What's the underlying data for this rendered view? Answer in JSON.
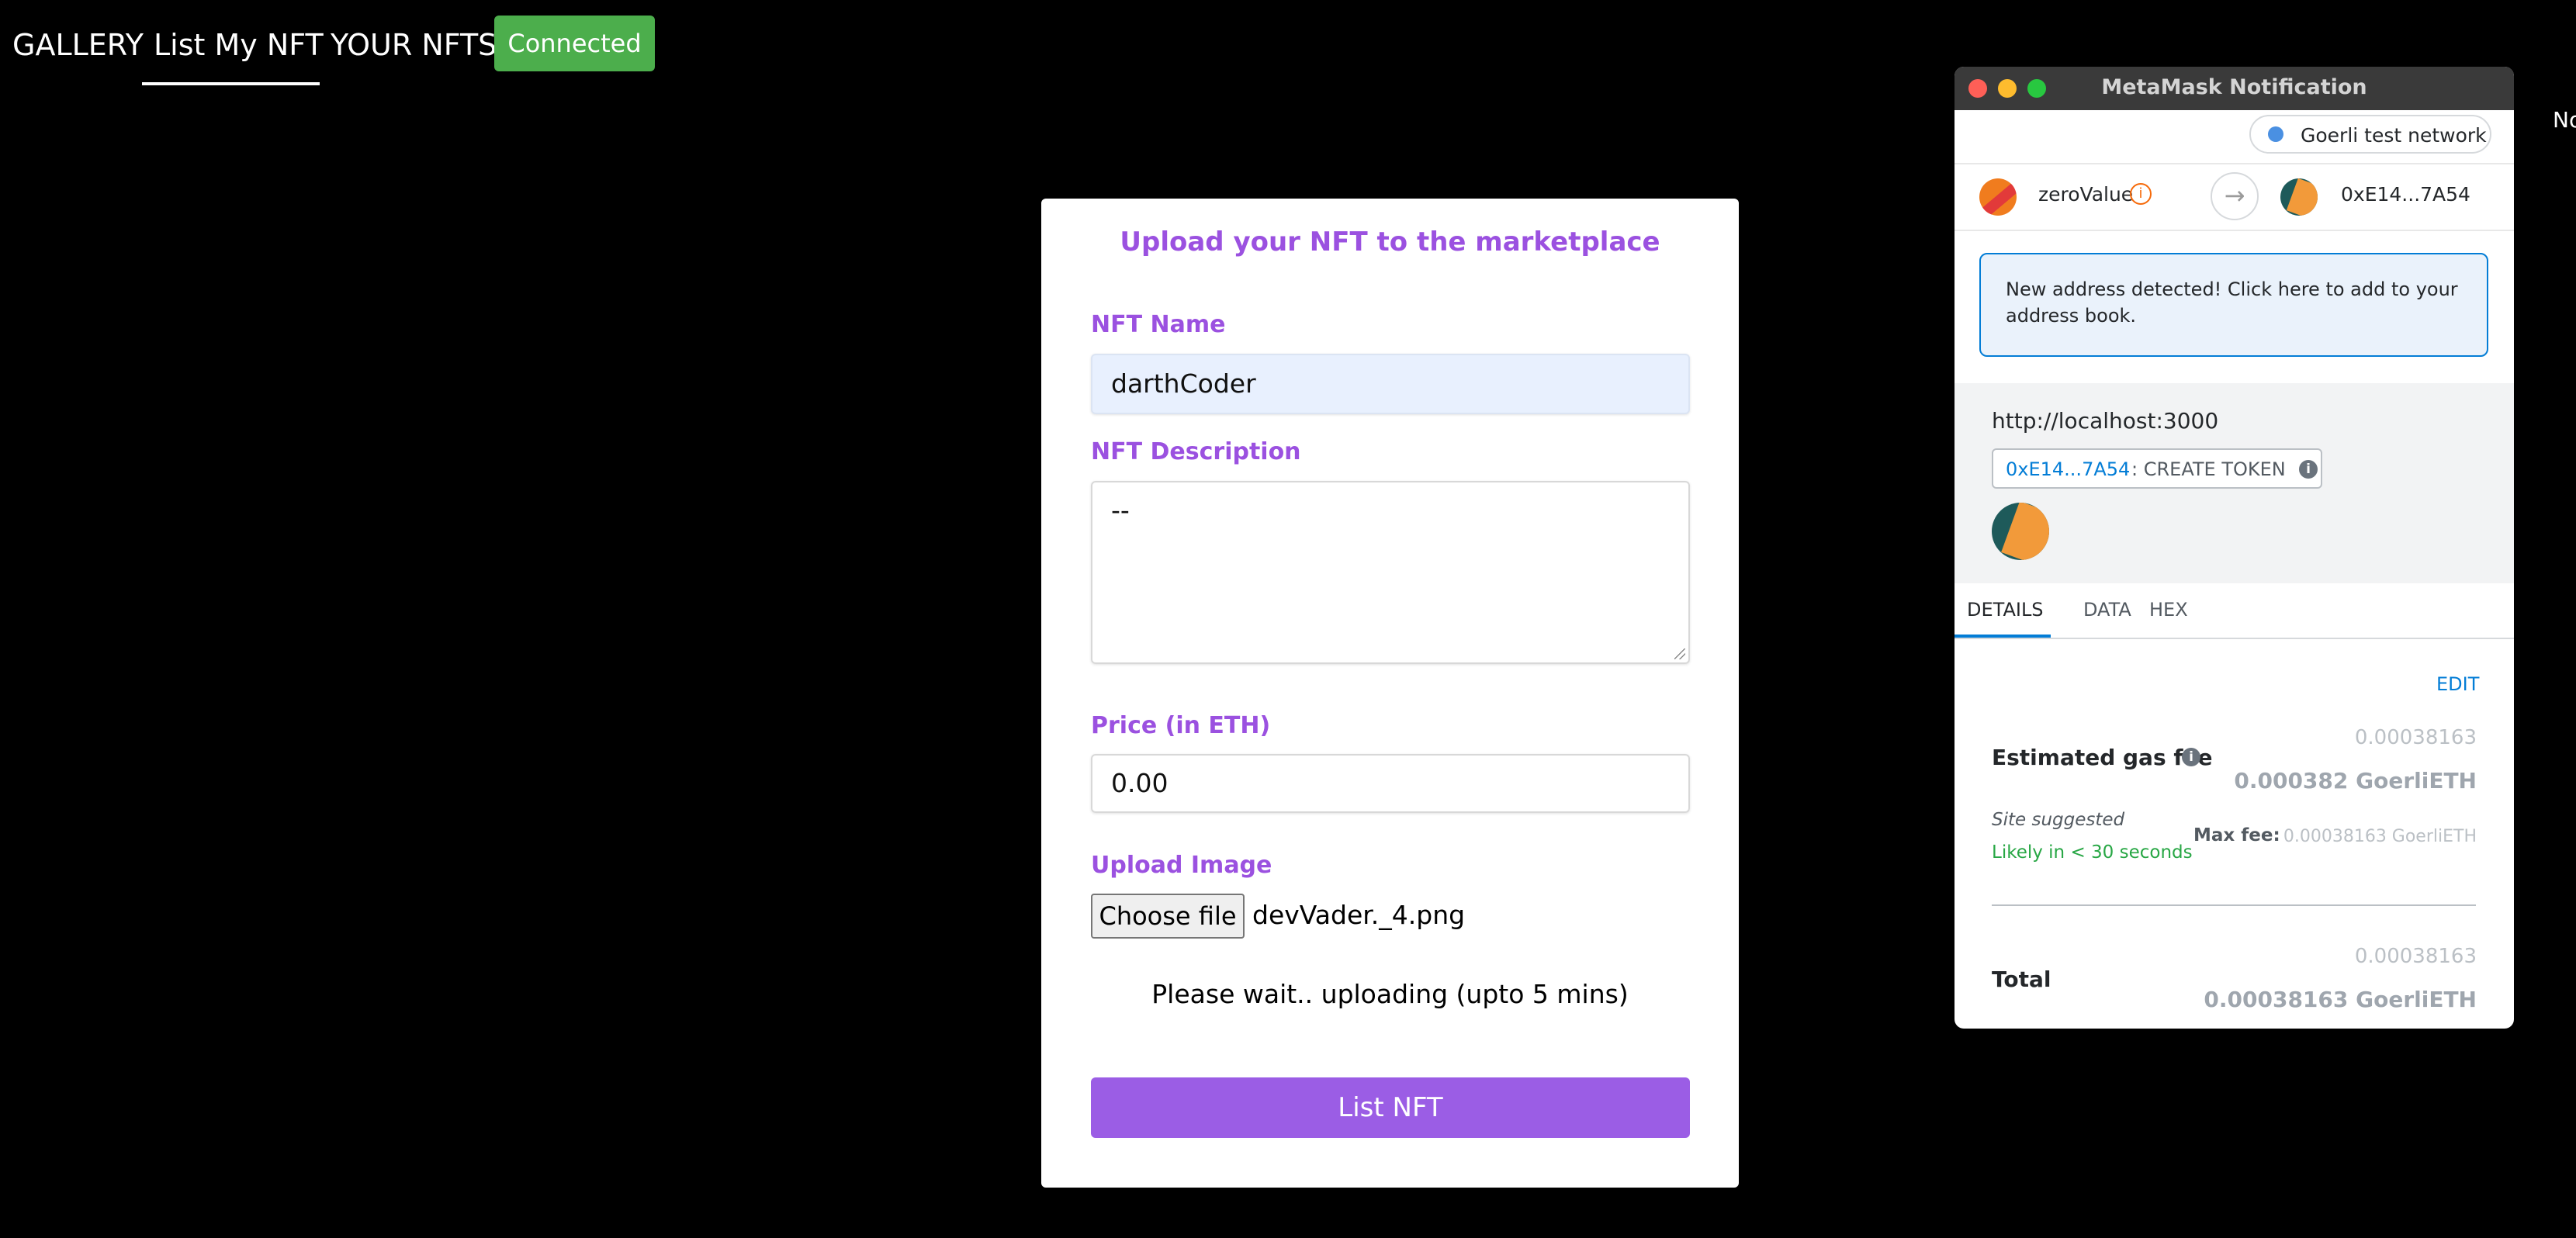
{
  "nav": {
    "gallery": "GALLERY",
    "list_my_nft": "List My NFT",
    "your_nfts": "YOUR NFTS",
    "connected": "Connected"
  },
  "form": {
    "title": "Upload your NFT to the marketplace",
    "name_label": "NFT Name",
    "name_value": "darthCoder",
    "description_label": "NFT Description",
    "description_value": "--",
    "price_label": "Price (in ETH)",
    "price_value": "0.00",
    "upload_label": "Upload Image",
    "choose_file": "Choose file",
    "file_name": "devVader._4.png",
    "wait_message": "Please wait.. uploading (upto 5 mins)",
    "submit": "List NFT"
  },
  "metamask": {
    "window_title": "MetaMask Notification",
    "network": "Goerli test network",
    "from_account": "zeroValue",
    "to_address": "0xE14...7A54",
    "new_address_notice": "New address detected! Click here to add to your address book.",
    "site_url": "http://localhost:3000",
    "method_address": "0xE14...7A54",
    "method_name": ": CREATE TOKEN",
    "tabs": [
      "DETAILS",
      "DATA",
      "HEX"
    ],
    "edit": "EDIT",
    "gas_fee_small": "0.00038163",
    "gas_fee_label": "Estimated gas fee",
    "gas_fee_value": "0.000382 GoerliETH",
    "site_suggested": "Site suggested",
    "likely": "Likely in < 30 seconds",
    "max_fee_label": "Max fee:",
    "max_fee_value": "0.00038163 GoerliETH",
    "total_small": "0.00038163",
    "total_label": "Total",
    "total_value": "0.00038163 GoerliETH"
  },
  "edge_text": "No",
  "colors": {
    "accent_purple": "#9b51e0",
    "button_purple": "#9b5de5",
    "connected_green": "#4cae4c",
    "metamask_blue": "#037dd6"
  }
}
